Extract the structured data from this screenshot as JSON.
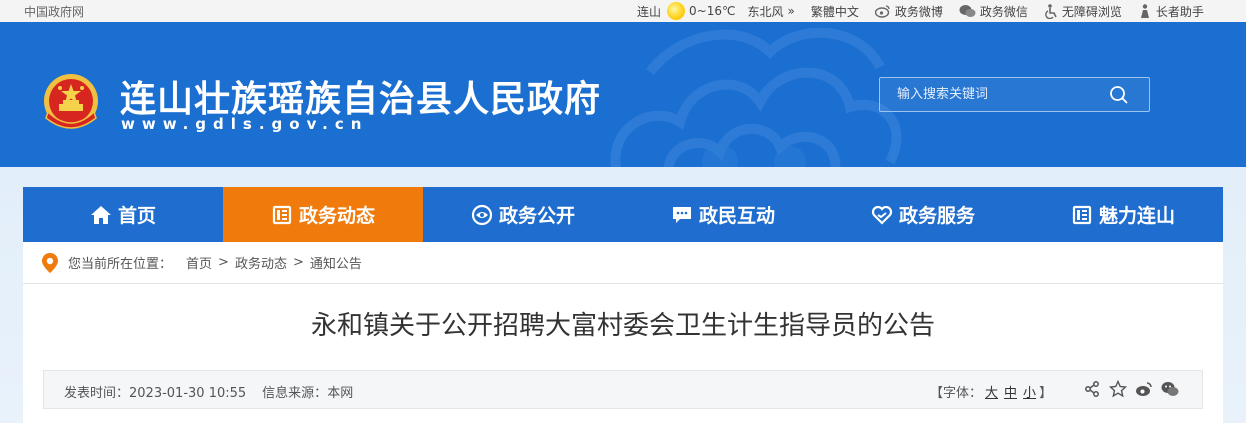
{
  "topbar": {
    "site": "中国政府网",
    "city": "连山",
    "temp": "0~16℃",
    "wind": "东北风",
    "links": [
      {
        "icon": "translate-icon",
        "label": "繁體中文"
      },
      {
        "icon": "weibo-icon",
        "label": "政务微博"
      },
      {
        "icon": "wechat-icon",
        "label": "政务微信"
      },
      {
        "icon": "accessibility-icon",
        "label": "无障碍浏览"
      },
      {
        "icon": "elder-icon",
        "label": "长者助手"
      }
    ]
  },
  "header": {
    "title": "连山壮族瑶族自治县人民政府",
    "url": "www.gdls.gov.cn",
    "search_placeholder": "输入搜索关键词"
  },
  "nav": {
    "items": [
      {
        "label": "首页",
        "icon": "home-icon",
        "active": false
      },
      {
        "label": "政务动态",
        "icon": "news-icon",
        "active": true
      },
      {
        "label": "政务公开",
        "icon": "eye-icon",
        "active": false
      },
      {
        "label": "政民互动",
        "icon": "chat-icon",
        "active": false
      },
      {
        "label": "政务服务",
        "icon": "heart-service-icon",
        "active": false
      },
      {
        "label": "魅力连山",
        "icon": "book-icon",
        "active": false
      }
    ]
  },
  "breadcrumb": {
    "label": "您当前所在位置：",
    "items": [
      "首页",
      "政务动态",
      "通知公告"
    ],
    "separator": ">"
  },
  "article": {
    "title": "永和镇关于公开招聘大富村委会卫生计生指导员的公告",
    "publish_label": "发表时间：",
    "publish_time": "2023-01-30 10:55",
    "source_label": "信息来源：",
    "source": "本网",
    "font_open": "【字体：",
    "font_large": "大",
    "font_medium": "中",
    "font_small": "小",
    "font_close": "】"
  },
  "colors": {
    "header_blue": "#1b6fd0",
    "nav_blue": "#1f6dcf",
    "nav_active": "#f07b0c"
  }
}
